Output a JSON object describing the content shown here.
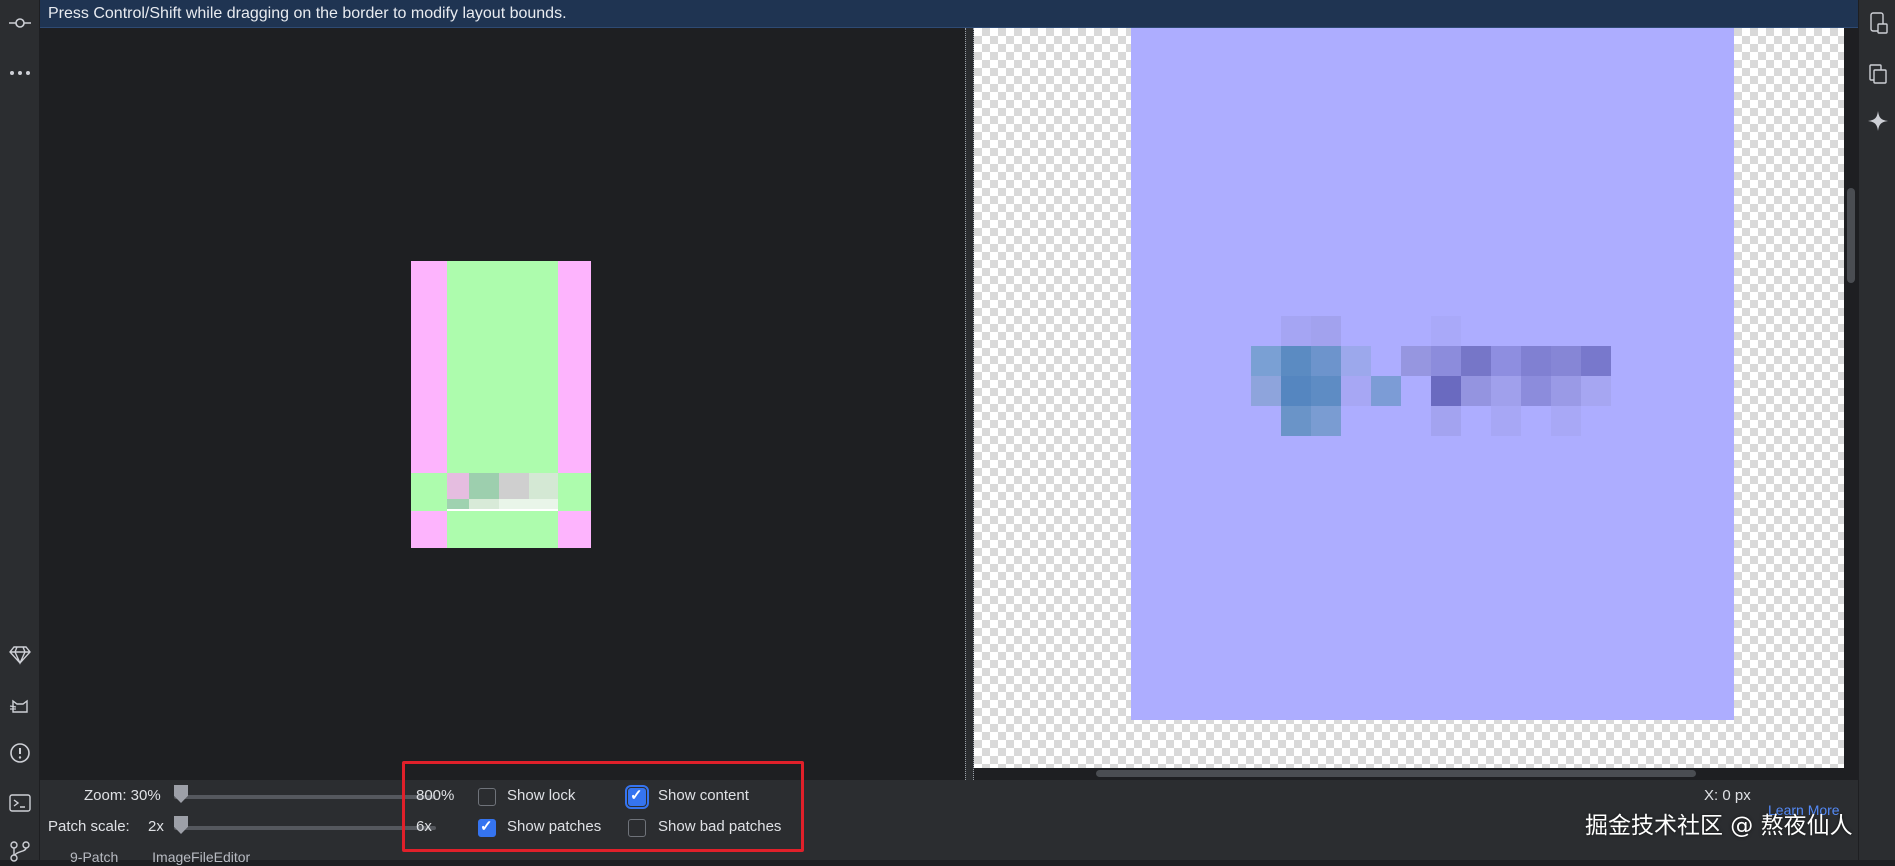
{
  "banner": {
    "hint": "Press Control/Shift while dragging on the border to modify layout bounds."
  },
  "left_bar": {
    "top_icons": [
      "commit-icon",
      "more-icon"
    ],
    "bottom_icons": [
      "gem-icon",
      "cat-icon",
      "problems-icon",
      "terminal-icon",
      "git-icon"
    ]
  },
  "right_bar": {
    "icons": [
      "device-manager-icon",
      "clipboard-icon",
      "sparkle-icon"
    ]
  },
  "controls": {
    "zoom_label": "Zoom: 30%",
    "zoom_max_label": "800%",
    "zoom_level": 0.0,
    "patch_scale_label": "Patch scale:",
    "patch_scale_value": "2x",
    "patch_scale_max": "6x",
    "patch_scale_level": 0.0,
    "show_lock": {
      "label": "Show lock",
      "checked": false
    },
    "show_patches": {
      "label": "Show patches",
      "checked": true
    },
    "show_content": {
      "label": "Show content",
      "checked": true
    },
    "show_bad_patches": {
      "label": "Show bad patches",
      "checked": false
    },
    "coordinates_x": "X: 0 px",
    "learn_more": "Learn More"
  },
  "bottom_tabs": {
    "tab1": "9-Patch",
    "tab2": "ImageFileEditor"
  },
  "watermark": "掘金技术社区 @ 熬夜仙人",
  "colors": {
    "banner_bg": "#1f3452",
    "patch_stretch": "#adfcad",
    "patch_fixed": "#fdb4fd",
    "preview_bg": "#adadff",
    "checkbox_checked": "#3574f0",
    "highlight": "#e0202a"
  }
}
